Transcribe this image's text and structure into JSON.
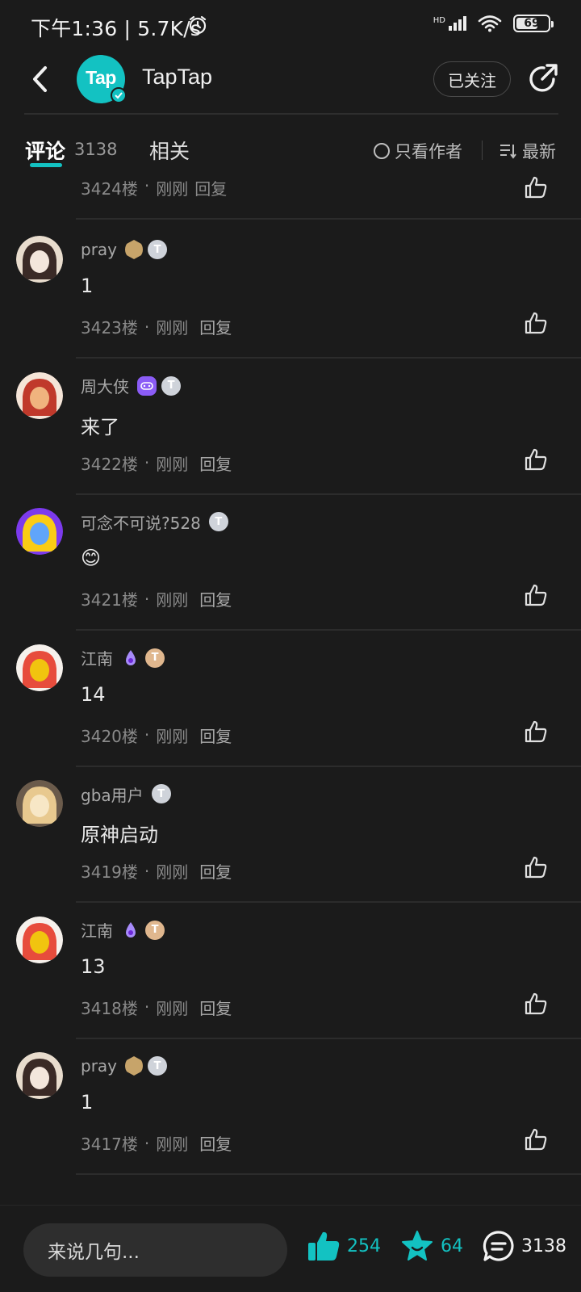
{
  "status_bar": {
    "time_speed": "下午1:36 | 5.7K/s",
    "network": "HD",
    "battery": "69",
    "battery_level": 0.69
  },
  "header": {
    "app_name": "TapTap",
    "logo_text": "Tap",
    "follow_label": "已关注"
  },
  "tabs": {
    "comments_label": "评论",
    "comments_count": "3138",
    "related_label": "相关",
    "author_only_label": "只看作者",
    "sort_label": "最新"
  },
  "partial_comment": {
    "floor": "3424楼",
    "time": "刚刚",
    "reply": "回复"
  },
  "comments": [
    {
      "username": "pray",
      "content": "1",
      "floor": "3423楼",
      "time": "刚刚",
      "reply": "回复",
      "badges": [
        "hex",
        "t"
      ],
      "avatar": "girl-dark"
    },
    {
      "username": "周大侠",
      "content": "来了",
      "floor": "3422楼",
      "time": "刚刚",
      "reply": "回复",
      "badges": [
        "game",
        "t"
      ],
      "avatar": "red-hero"
    },
    {
      "username": "可念不可说?528",
      "content": "😊",
      "floor": "3421楼",
      "time": "刚刚",
      "reply": "回复",
      "badges": [
        "t"
      ],
      "avatar": "purple"
    },
    {
      "username": "江南",
      "content": "14",
      "floor": "3420楼",
      "time": "刚刚",
      "reply": "回复",
      "badges": [
        "flame",
        "t-gold"
      ],
      "avatar": "colorful"
    },
    {
      "username": "gba用户",
      "content": "原神启动",
      "floor": "3419楼",
      "time": "刚刚",
      "reply": "回复",
      "badges": [
        "t"
      ],
      "avatar": "golden"
    },
    {
      "username": "江南",
      "content": "13",
      "floor": "3418楼",
      "time": "刚刚",
      "reply": "回复",
      "badges": [
        "flame",
        "t-gold"
      ],
      "avatar": "colorful"
    },
    {
      "username": "pray",
      "content": "1",
      "floor": "3417楼",
      "time": "刚刚",
      "reply": "回复",
      "badges": [
        "hex",
        "t"
      ],
      "avatar": "girl-dark"
    }
  ],
  "bottom_bar": {
    "input_placeholder": "来说几句...",
    "like_count": "254",
    "fav_count": "64",
    "comment_count": "3138"
  },
  "colors": {
    "accent": "#13c2c2",
    "background": "#1b1b1b"
  }
}
